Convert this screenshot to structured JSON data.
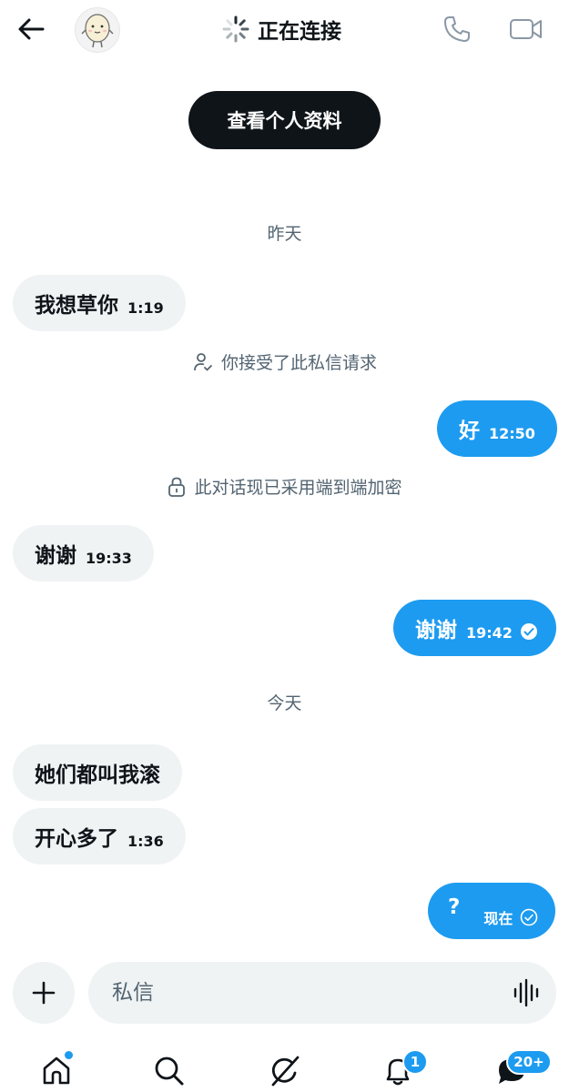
{
  "header": {
    "title": "正在连接",
    "back_icon": "arrow-left-icon",
    "call_icon": "phone-icon",
    "video_icon": "video-camera-icon"
  },
  "profile_button": {
    "label": "查看个人资料"
  },
  "conversation": {
    "day_yesterday": "昨天",
    "day_today": "今天",
    "messages": [
      {
        "direction": "in",
        "text": "我想草你",
        "time": "1:19"
      },
      {
        "direction": "system",
        "icon": "person-check-icon",
        "text": "你接受了此私信请求"
      },
      {
        "direction": "out",
        "text": "好",
        "time": "12:50"
      },
      {
        "direction": "system",
        "icon": "lock-icon",
        "text": "此对话现已采用端到端加密"
      },
      {
        "direction": "in",
        "text": "谢谢",
        "time": "19:33"
      },
      {
        "direction": "out",
        "text": "谢谢",
        "time": "19:42",
        "status": "read"
      },
      {
        "direction": "in",
        "text": "她们都叫我滚",
        "time": ""
      },
      {
        "direction": "in",
        "text": "开心多了",
        "time": "1:36"
      },
      {
        "direction": "out",
        "text": "?",
        "time": "现在",
        "status": "sent"
      }
    ]
  },
  "composer": {
    "placeholder": "私信"
  },
  "nav": {
    "notifications_badge": "1",
    "messages_badge": "20+"
  },
  "colors": {
    "accent": "#1d9bf0",
    "bubble_in": "#eff3f4",
    "text_primary": "#0f1419",
    "text_secondary": "#536471"
  }
}
